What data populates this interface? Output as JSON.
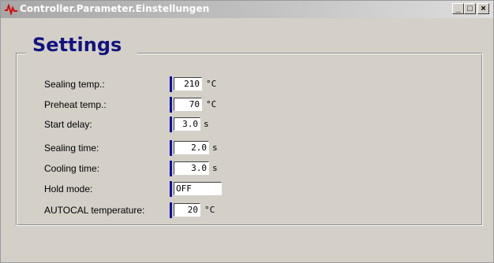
{
  "window": {
    "title": "Controller.Parameter.Einstellungen",
    "controls": {
      "minimize": "_",
      "maximize": "□",
      "close": "×"
    }
  },
  "group": {
    "title": "Settings"
  },
  "params": [
    {
      "label": "Sealing temp.:",
      "value": "210",
      "unit": "°C"
    },
    {
      "label": "Preheat temp.:",
      "value": "70",
      "unit": "°C"
    },
    {
      "label": "Start delay:",
      "value": "3.0",
      "unit": "s"
    },
    {
      "label": "Sealing time:",
      "value": "2.0",
      "unit": "s"
    },
    {
      "label": "Cooling time:",
      "value": "3.0",
      "unit": "s"
    },
    {
      "label": "Hold mode:",
      "value": "OFF",
      "unit": ""
    },
    {
      "label": "AUTOCAL temperature:",
      "value": "20",
      "unit": "°C"
    }
  ]
}
